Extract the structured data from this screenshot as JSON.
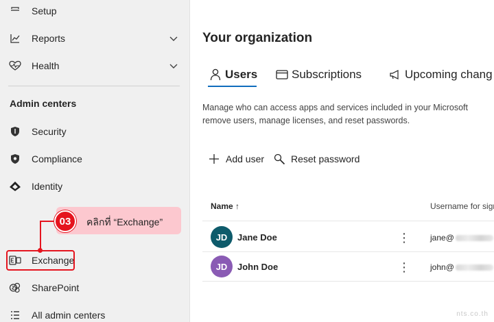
{
  "sidebar": {
    "items": [
      {
        "label": "Setup",
        "icon": "setup-icon"
      },
      {
        "label": "Reports",
        "icon": "reports-icon",
        "expandable": true
      },
      {
        "label": "Health",
        "icon": "health-icon",
        "expandable": true
      }
    ],
    "section_header": "Admin centers",
    "admin_centers": [
      {
        "label": "Security",
        "icon": "security-shield-icon"
      },
      {
        "label": "Compliance",
        "icon": "compliance-shield-icon"
      },
      {
        "label": "Identity",
        "icon": "identity-icon"
      },
      {
        "label": "Exchange",
        "icon": "exchange-icon"
      },
      {
        "label": "SharePoint",
        "icon": "sharepoint-icon"
      },
      {
        "label": "All admin centers",
        "icon": "all-admin-centers-icon"
      }
    ]
  },
  "callout": {
    "step": "03",
    "text": "คลิกที่ “Exchange”",
    "accent_color": "#e5141e",
    "bubble_color": "#fcc8cf"
  },
  "main": {
    "title": "Your organization",
    "tabs": [
      {
        "label": "Users",
        "icon": "person-icon",
        "active": true
      },
      {
        "label": "Subscriptions",
        "icon": "subscriptions-icon"
      },
      {
        "label": "Upcoming chang",
        "icon": "megaphone-icon"
      }
    ],
    "description_line1": "Manage who can access apps and services included in your Microsoft",
    "description_line2": "remove users, manage licenses, and reset passwords.",
    "commands": {
      "add_user": "Add user",
      "reset_password": "Reset password"
    },
    "columns": {
      "name": "Name ↑",
      "username": "Username for sign"
    },
    "users": [
      {
        "initials": "JD",
        "name": "Jane Doe",
        "email_prefix": "jane@",
        "avatar_color": "#0e5b6b"
      },
      {
        "initials": "JD",
        "name": "John Doe",
        "email_prefix": "john@",
        "avatar_color": "#8a5bb4"
      }
    ]
  },
  "watermark": "nts.co.th"
}
